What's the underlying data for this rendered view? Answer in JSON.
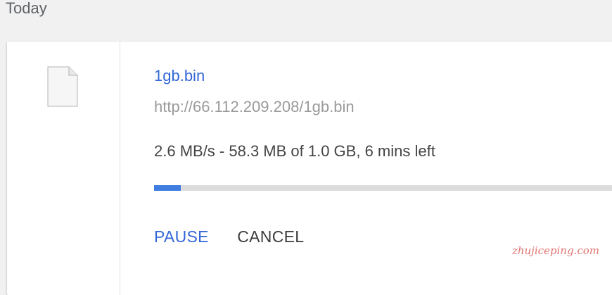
{
  "section": {
    "header": "Today"
  },
  "download": {
    "file_icon": "file-icon",
    "file_name": "1gb.bin",
    "url": "http://66.112.209.208/1gb.bin",
    "status": "2.6 MB/s - 58.3 MB of 1.0 GB, 6 mins left",
    "progress_percent": 5.8,
    "actions": {
      "pause_label": "PAUSE",
      "cancel_label": "CANCEL"
    }
  },
  "watermark": "zhujiceping.com",
  "colors": {
    "link_blue": "#3367d6",
    "progress_fill": "#3f7de0",
    "progress_track": "#dcdcdc",
    "page_background": "#f1f1f1"
  }
}
